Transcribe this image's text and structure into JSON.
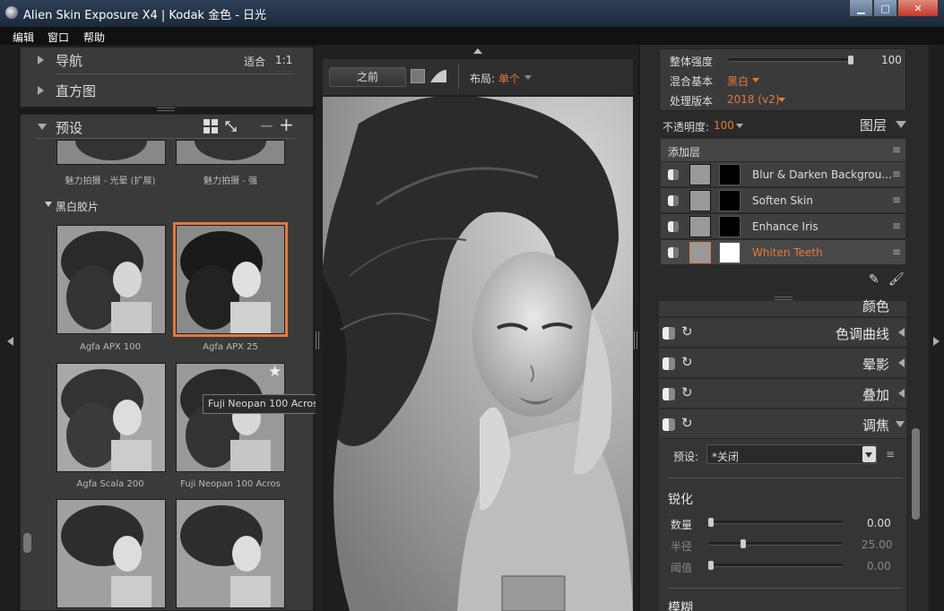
{
  "window": {
    "title": "Alien Skin Exposure X4 | Kodak 金色 - 日光",
    "min": "▁",
    "max": "□",
    "close": "✕"
  },
  "menu": [
    "编辑",
    "窗口",
    "帮助"
  ],
  "left": {
    "nav_label": "导航",
    "fit_label": "适合",
    "ratio_label": "1:1",
    "histogram_label": "直方图",
    "presets_label": "预设",
    "minus": "−",
    "plus": "+",
    "top_captions": [
      "魅力拍摄 - 光晕 (扩展)",
      "魅力拍摄 - 强"
    ],
    "category": "黑白胶片",
    "presets": [
      "Agfa APX 100",
      "Agfa APX 25",
      "Agfa Scala 200",
      "Fuji Neopan 100 Acros"
    ],
    "tooltip": "Fuji Neopan 100 Acros",
    "star": "★"
  },
  "center": {
    "before_label": "之前",
    "layout_label": "布局:",
    "layout_value": "单个"
  },
  "right": {
    "strength_label": "整体强度",
    "strength_value": "100",
    "strength_level": 1.0,
    "blend_label": "混合基本",
    "blend_value": "黑白",
    "version_label": "处理版本",
    "version_value": "2018 (v2)",
    "opacity_label": "不透明度:",
    "opacity_value": "100",
    "layers_label": "图层",
    "add_layer": "添加层",
    "layers": [
      "Blur & Darken Backgrou...",
      "Soften Skin",
      "Enhance Iris",
      "Whiten Teeth"
    ],
    "partial_section": "颜色",
    "sections": [
      "色调曲线",
      "晕影",
      "叠加",
      "调焦"
    ],
    "preset_label": "预设:",
    "preset_value": "*关闭",
    "sharpen_label": "锐化",
    "sliders": [
      {
        "label": "数量",
        "value": "0.00",
        "level": 0.0
      },
      {
        "label": "半径",
        "value": "25.00",
        "level": 0.25
      },
      {
        "label": "阈值",
        "value": "0.00",
        "level": 0.0
      }
    ],
    "bottom_partial": "模糊"
  },
  "colors": {
    "accent": "#e57a3a",
    "panel": "#3a3a3a",
    "bg": "#1a1a1a"
  }
}
